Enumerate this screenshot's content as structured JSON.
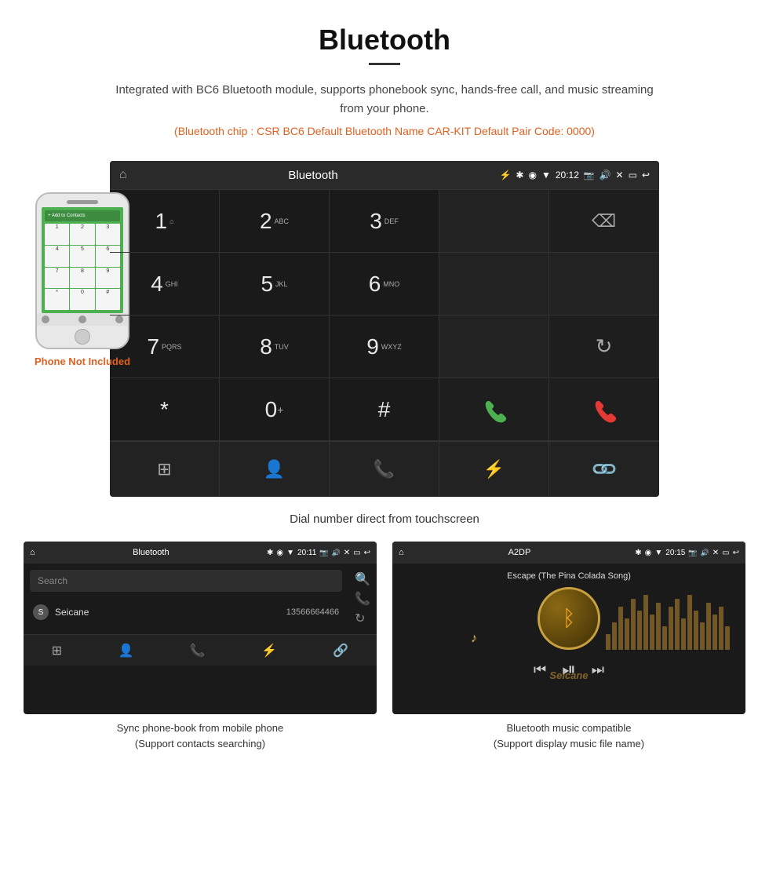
{
  "page": {
    "title": "Bluetooth",
    "divider": true,
    "description": "Integrated with BC6 Bluetooth module, supports phonebook sync, hands-free call, and music streaming from your phone.",
    "specs": "(Bluetooth chip : CSR BC6    Default Bluetooth Name CAR-KIT    Default Pair Code: 0000)",
    "caption_main": "Dial number direct from touchscreen",
    "phone_not_included": "Phone Not Included",
    "caption_left": "Sync phone-book from mobile phone\n(Support contacts searching)",
    "caption_right": "Bluetooth music compatible\n(Support display music file name)"
  },
  "dial_screen": {
    "status_bar": {
      "app_name": "Bluetooth",
      "time": "20:12",
      "usb_icon": "⚡",
      "bt_icon": "✱",
      "location_icon": "◉",
      "wifi_icon": "▼",
      "camera_icon": "📷",
      "volume_icon": "🔊",
      "close_icon": "✕",
      "window_icon": "▭",
      "back_icon": "↩"
    },
    "keys": [
      {
        "main": "1",
        "sub": "⌂",
        "type": "number"
      },
      {
        "main": "2",
        "sub": "ABC",
        "type": "number"
      },
      {
        "main": "3",
        "sub": "DEF",
        "type": "number"
      },
      {
        "main": "",
        "sub": "",
        "type": "empty"
      },
      {
        "main": "⌫",
        "sub": "",
        "type": "backspace"
      },
      {
        "main": "4",
        "sub": "GHI",
        "type": "number"
      },
      {
        "main": "5",
        "sub": "JKL",
        "type": "number"
      },
      {
        "main": "6",
        "sub": "MNO",
        "type": "number"
      },
      {
        "main": "",
        "sub": "",
        "type": "empty"
      },
      {
        "main": "",
        "sub": "",
        "type": "empty"
      },
      {
        "main": "7",
        "sub": "PQRS",
        "type": "number"
      },
      {
        "main": "8",
        "sub": "TUV",
        "type": "number"
      },
      {
        "main": "9",
        "sub": "WXYZ",
        "type": "number"
      },
      {
        "main": "",
        "sub": "",
        "type": "empty"
      },
      {
        "main": "↻",
        "sub": "",
        "type": "refresh"
      },
      {
        "main": "*",
        "sub": "",
        "type": "number"
      },
      {
        "main": "0",
        "sub": "+",
        "type": "number_plus"
      },
      {
        "main": "#",
        "sub": "",
        "type": "number"
      },
      {
        "main": "☎",
        "sub": "",
        "type": "call_green"
      },
      {
        "main": "☎",
        "sub": "",
        "type": "call_red"
      }
    ],
    "bottom_icons": [
      "grid",
      "person",
      "phone",
      "bluetooth",
      "link"
    ]
  },
  "phonebook_screen": {
    "status_bar": {
      "app_name": "Bluetooth",
      "time": "20:11",
      "usb_icon": "⚡"
    },
    "search_placeholder": "Search",
    "contacts": [
      {
        "initial": "S",
        "name": "Seicane",
        "number": "13566664466"
      }
    ],
    "side_icons": [
      "search",
      "phone",
      "refresh"
    ],
    "bottom_icons": [
      "grid",
      "person_yellow",
      "phone",
      "bluetooth",
      "link"
    ]
  },
  "music_screen": {
    "status_bar": {
      "app_name": "A2DP",
      "time": "20:15"
    },
    "song_title": "Escape (The Pina Colada Song)",
    "controls": [
      "skip_prev",
      "play_pause",
      "skip_next"
    ],
    "watermark": "Seicane",
    "eq_bars": [
      20,
      35,
      55,
      40,
      65,
      50,
      70,
      45,
      60,
      30,
      55,
      65,
      40,
      70,
      50,
      35,
      60,
      45,
      55,
      30
    ]
  }
}
